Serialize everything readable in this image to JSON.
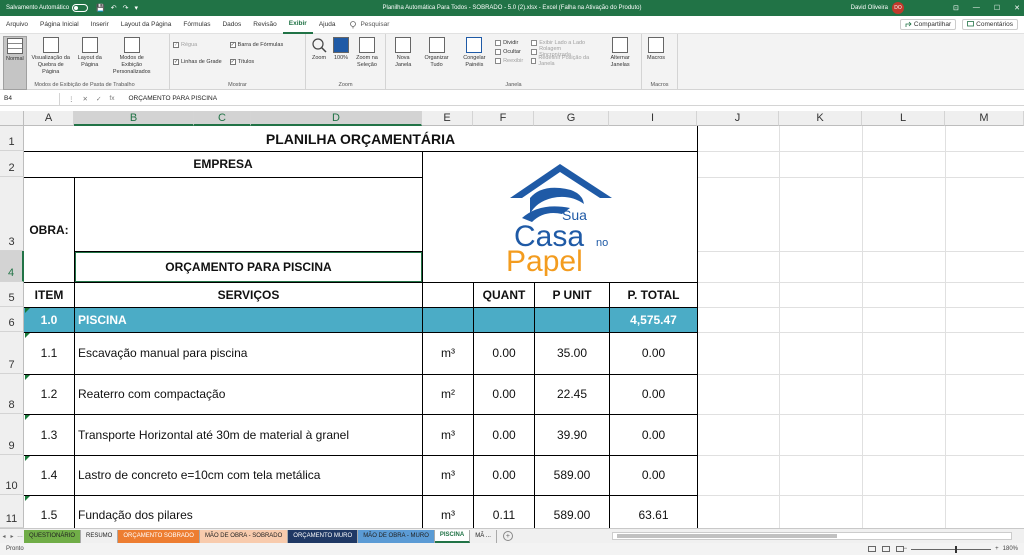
{
  "titlebar": {
    "autosave_label": "Salvamento Automático",
    "window_title": "Planilha Automática Para Todos - SOBRADO - 5.0 (2).xlsx  -  Excel (Falha na Ativação do Produto)",
    "user_name": "David Oliveira",
    "avatar_initials": "DO",
    "qat": [
      "💾",
      "↶",
      "↷",
      "▾"
    ],
    "win_buttons": [
      "⊡",
      "—",
      "☐",
      "✕"
    ]
  },
  "menu": {
    "tabs": [
      "Arquivo",
      "Página Inicial",
      "Inserir",
      "Layout da Página",
      "Fórmulas",
      "Dados",
      "Revisão",
      "Exibir",
      "Ajuda"
    ],
    "active_tab": "Exibir",
    "search_label": "Pesquisar",
    "share_label": "Compartilhar",
    "comments_label": "Comentários"
  },
  "ribbon": {
    "views_group": {
      "label": "Modos de Exibição de Pasta de Trabalho",
      "buttons": [
        "Normal",
        "Visualização da Quebra de Página",
        "Layout da Página",
        "Modos de Exibição Personalizados"
      ]
    },
    "show_group": {
      "label": "Mostrar",
      "regua": "Régua",
      "linhas": "Linhas de Grade",
      "barra": "Barra de Fórmulas",
      "titulos": "Títulos"
    },
    "zoom_group": {
      "label": "Zoom",
      "buttons": [
        "Zoom",
        "100%",
        "Zoom na Seleção"
      ]
    },
    "window_group": {
      "label": "Janela",
      "buttons": [
        "Nova Janela",
        "Organizar Tudo",
        "Congelar Painéis"
      ],
      "small": [
        "Dividir",
        "Ocultar",
        "Reexibir"
      ],
      "small_dim": [
        "Exibir Lado a Lado",
        "Rolagem Sincronizada",
        "Redefinir Posição da Janela"
      ],
      "switch": "Alternar Janelas"
    },
    "macros_group": {
      "label": "Macros",
      "button": "Macros"
    }
  },
  "formulabar": {
    "name_box": "B4",
    "icons": [
      "⋮",
      "✕",
      "✓",
      "fx"
    ],
    "content": "ORÇAMENTO PARA PISCINA"
  },
  "columns": [
    "A",
    "B",
    "C",
    "D",
    "E",
    "F",
    "G",
    "I",
    "J",
    "K",
    "L",
    "M"
  ],
  "rows": [
    "1",
    "2",
    "3",
    "4",
    "5",
    "6",
    "7",
    "8",
    "9",
    "10",
    "11"
  ],
  "sheet": {
    "title": "PLANILHA ORÇAMENTÁRIA",
    "empresa": "EMPRESA",
    "obra": "OBRA:",
    "orcamento": "ORÇAMENTO PARA PISCINA",
    "headers": {
      "item": "ITEM",
      "servicos": "SERVIÇOS",
      "quant": "QUANT",
      "punit": "P UNIT",
      "ptotal": "P. TOTAL"
    },
    "section": {
      "item": "1.0",
      "name": "PISCINA",
      "total": "4,575.47"
    },
    "items": [
      {
        "item": "1.1",
        "desc": "Escavação manual para piscina",
        "unit": "m³",
        "quant": "0.00",
        "punit": "35.00",
        "ptotal": "0.00"
      },
      {
        "item": "1.2",
        "desc": "Reaterro com compactação",
        "unit": "m²",
        "quant": "0.00",
        "punit": "22.45",
        "ptotal": "0.00"
      },
      {
        "item": "1.3",
        "desc": "Transporte Horizontal até 30m de material à granel",
        "unit": "m³",
        "quant": "0.00",
        "punit": "39.90",
        "ptotal": "0.00"
      },
      {
        "item": "1.4",
        "desc": "Lastro de concreto e=10cm com tela metálica",
        "unit": "m³",
        "quant": "0.00",
        "punit": "589.00",
        "ptotal": "0.00"
      },
      {
        "item": "1.5",
        "desc": "Fundação dos pilares",
        "unit": "m³",
        "quant": "0.11",
        "punit": "589.00",
        "ptotal": "63.61"
      }
    ],
    "logo": {
      "word1": "Sua",
      "word2": "Casa",
      "word3": "no",
      "word4": "Papel",
      "blue": "#1f5aa6",
      "orange": "#f39c1f"
    }
  },
  "sheet_tabs": [
    {
      "label": "QUESTIONÁRIO",
      "color": "#70ad47"
    },
    {
      "label": "RESUMO",
      "color": "#f0f0f0"
    },
    {
      "label": "ORÇAMENTO SOBRADO",
      "color": "#ed7d31"
    },
    {
      "label": "MÃO DE OBRA - SOBRADO",
      "color": "#f8cbad"
    },
    {
      "label": "ORÇAMENTO MURO",
      "color": "#1f3864"
    },
    {
      "label": "MÃO DE OBRA - MURO",
      "color": "#5b9bd5"
    },
    {
      "label": "PISCINA",
      "color": "#ffffff"
    },
    {
      "label": "MÃ ...",
      "color": "#f0f0f0"
    }
  ],
  "status": {
    "ready": "Pronto",
    "zoom": "180%"
  },
  "colors": {
    "accent": "#217346",
    "section_fill": "#4bacc6"
  }
}
